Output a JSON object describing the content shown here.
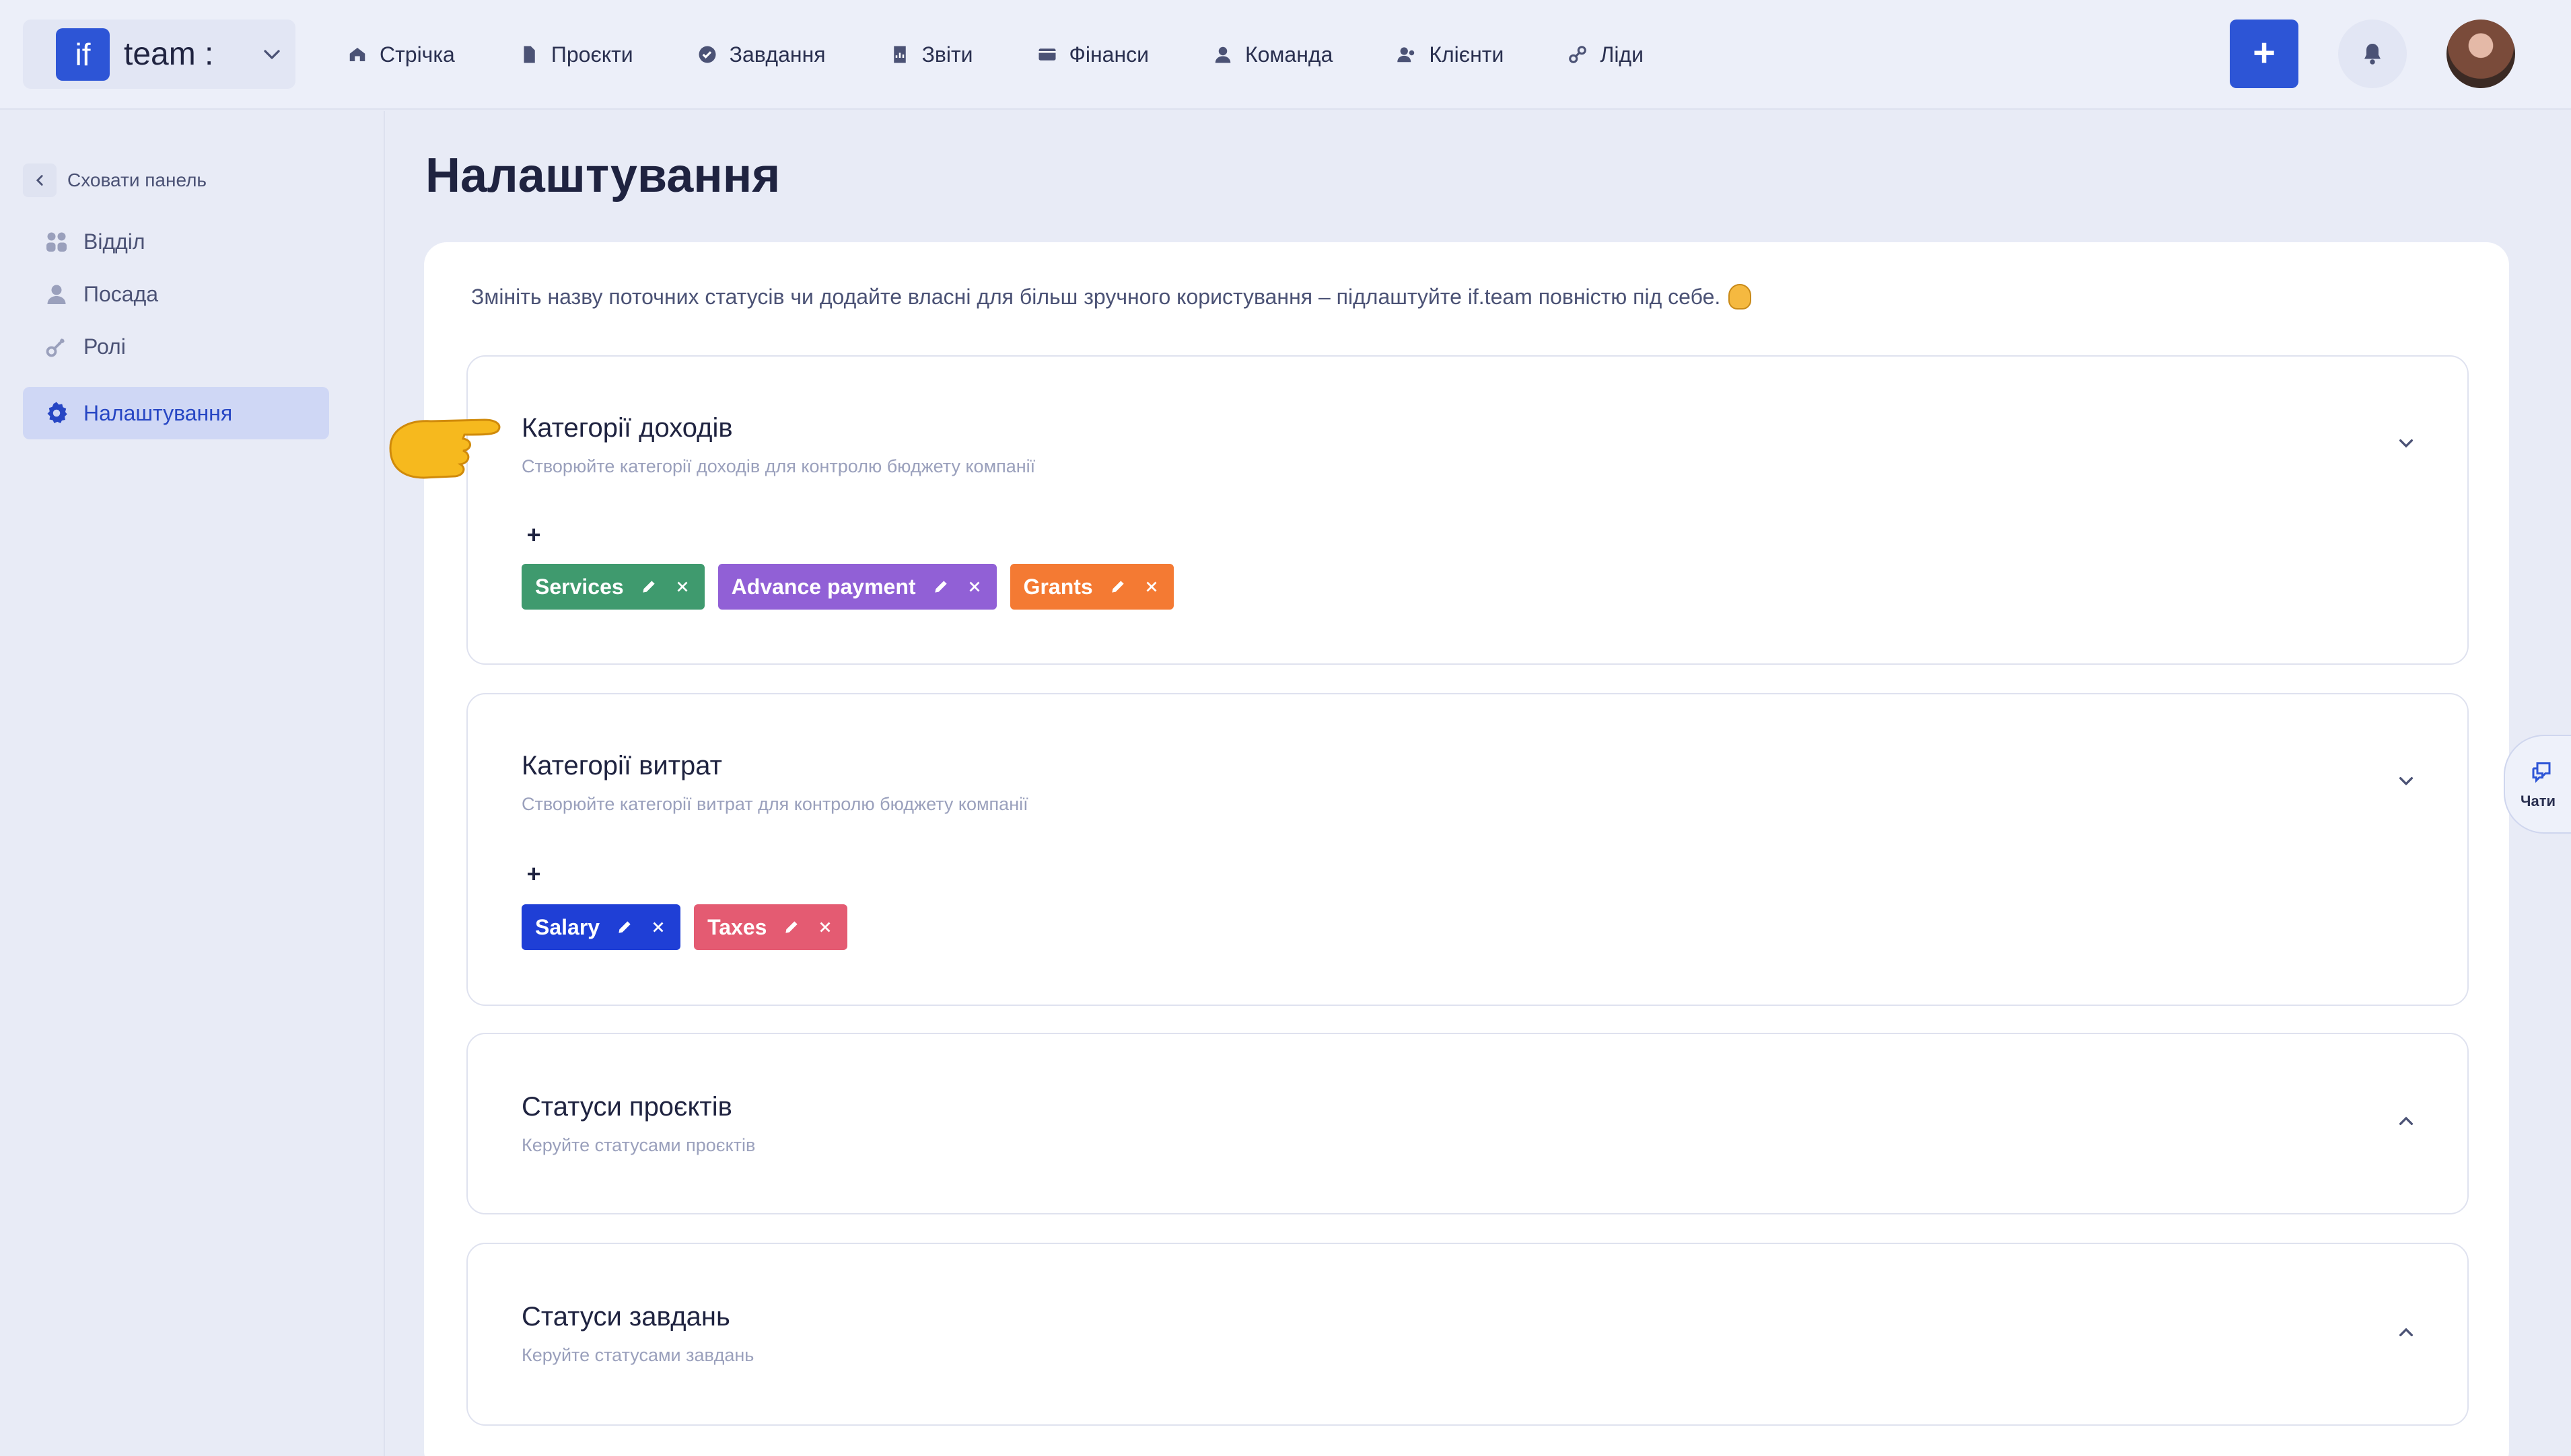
{
  "brand": {
    "logo_text": "if",
    "name": "team :"
  },
  "nav": [
    {
      "label": "Стрічка",
      "icon": "home-icon"
    },
    {
      "label": "Проєкти",
      "icon": "document-icon"
    },
    {
      "label": "Завдання",
      "icon": "check-circle-icon"
    },
    {
      "label": "Звіти",
      "icon": "report-icon"
    },
    {
      "label": "Фінанси",
      "icon": "wallet-icon"
    },
    {
      "label": "Команда",
      "icon": "user-icon"
    },
    {
      "label": "Клієнти",
      "icon": "users-icon"
    },
    {
      "label": "Ліди",
      "icon": "link-icon"
    }
  ],
  "header_actions": {
    "add_label": "+"
  },
  "sidebar": {
    "hide_label": "Сховати панель",
    "items": [
      {
        "label": "Відділ",
        "icon": "group-icon"
      },
      {
        "label": "Посада",
        "icon": "user-icon"
      },
      {
        "label": "Ролі",
        "icon": "key-icon"
      },
      {
        "label": "Налаштування",
        "icon": "gear-icon",
        "active": true
      }
    ]
  },
  "page": {
    "title": "Налаштування",
    "intro": "Змініть назву поточних статусів чи додайте власні для більш зручного користування – підлаштуйте if.team повністю під себе."
  },
  "sections": [
    {
      "title": "Категорії доходів",
      "subtitle": "Створюйте категорії доходів для контролю бюджету компанії",
      "expanded": true,
      "add_label": "+",
      "tags": [
        {
          "label": "Services",
          "color": "#3f9a6e"
        },
        {
          "label": "Advance payment",
          "color": "#9160d6"
        },
        {
          "label": "Grants",
          "color": "#f47a33"
        }
      ]
    },
    {
      "title": "Категорії витрат",
      "subtitle": "Створюйте категорії витрат для контролю бюджету компанії",
      "expanded": true,
      "add_label": "+",
      "tags": [
        {
          "label": "Salary",
          "color": "#1f3fd6"
        },
        {
          "label": "Taxes",
          "color": "#e45b72"
        }
      ]
    },
    {
      "title": "Статуси проєктів",
      "subtitle": "Керуйте статусами проєктів",
      "expanded": false
    },
    {
      "title": "Статуси завдань",
      "subtitle": "Керуйте статусами завдань",
      "expanded": false
    }
  ],
  "chat_tab": {
    "label": "Чати"
  },
  "colors": {
    "accent": "#2d55d6",
    "active_bg": "#cfd7f5"
  }
}
